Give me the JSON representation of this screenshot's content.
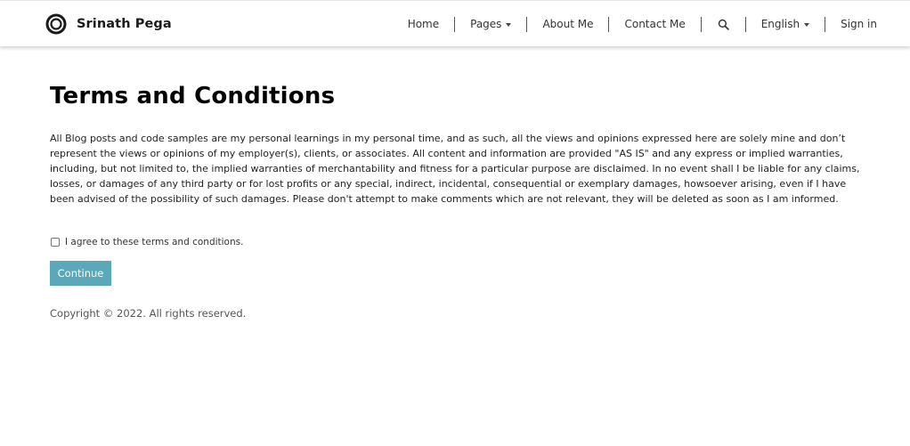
{
  "header": {
    "brand_name": "Srinath Pega",
    "logo_icon": "ring-logo-icon",
    "nav": {
      "home": "Home",
      "pages": "Pages",
      "about": "About Me",
      "contact": "Contact Me",
      "search_icon": "search-icon",
      "language": "English",
      "sign_in": "Sign in"
    }
  },
  "main": {
    "title": "Terms and Conditions",
    "body": "All Blog posts and code samples are my personal learnings in my personal time, and as such, all the views and opinions expressed here are solely mine and don’t represent the views or opinions of my employer(s), clients, or associates. All content and information are provided \"AS IS\" and any express or implied warranties, including, but not limited to, the implied warranties of merchantability and fitness for a particular purpose are disclaimed. In no event shall I be liable for any claims, losses, or damages of any third party or for lost profits or any special, indirect, incidental, consequential or exemplary damages, howsoever arising, even if I have been advised of the possibility of such damages. Please don't attempt to make comments which are not relevant, they will be deleted as soon as I am informed.",
    "agree_label": "I agree to these terms and conditions.",
    "agree_checked": false,
    "continue_label": "Continue",
    "copyright": "Copyright © 2022. All rights reserved."
  },
  "colors": {
    "button_bg": "#5ba8bb",
    "title": "#000000",
    "text": "#222222"
  }
}
